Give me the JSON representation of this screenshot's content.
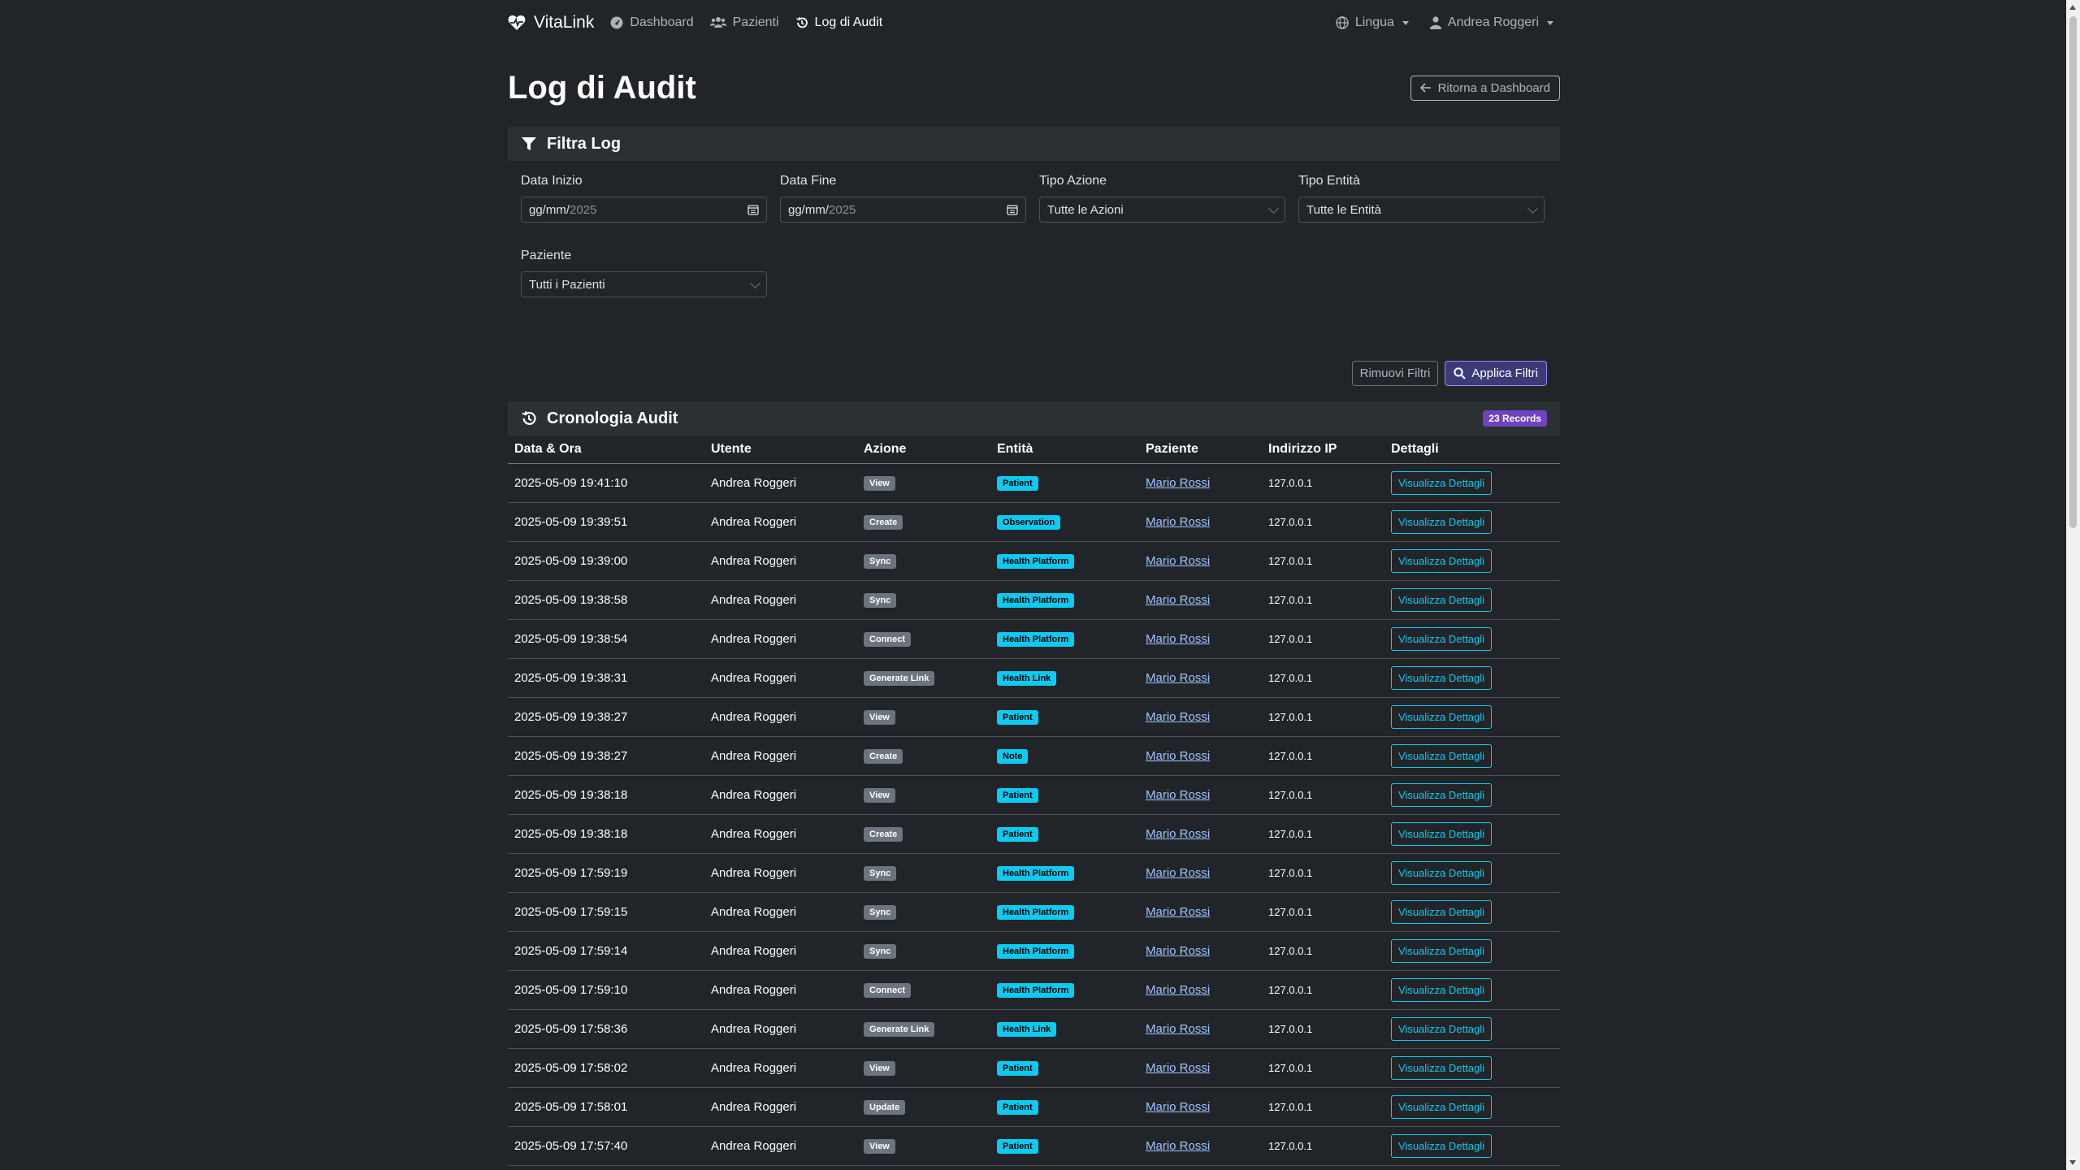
{
  "nav": {
    "brand": "VitaLink",
    "links": [
      {
        "label": "Dashboard",
        "icon": "tachometer-icon"
      },
      {
        "label": "Pazienti",
        "icon": "users-icon"
      },
      {
        "label": "Log di Audit",
        "icon": "history-icon"
      }
    ],
    "language": "Lingua",
    "user": "Andrea Roggeri"
  },
  "header": {
    "title": "Log di Audit",
    "back_button": "Ritorna a Dashboard"
  },
  "filters": {
    "title": "Filtra Log",
    "start_date": {
      "label": "Data Inizio",
      "value_prefix": "gg/mm/",
      "value_year": "2025"
    },
    "end_date": {
      "label": "Data Fine",
      "value_prefix": "gg/mm/",
      "value_year": "2025"
    },
    "action_type": {
      "label": "Tipo Azione",
      "value": "Tutte le Azioni"
    },
    "entity_type": {
      "label": "Tipo Entità",
      "value": "Tutte le Entità"
    },
    "patient": {
      "label": "Paziente",
      "value": "Tutti i Pazienti"
    },
    "remove_button": "Rimuovi Filtri",
    "apply_button": "Applica Filtri"
  },
  "audit": {
    "title": "Cronologia Audit",
    "records_badge": "23 Records",
    "columns": [
      "Data & Ora",
      "Utente",
      "Azione",
      "Entità",
      "Paziente",
      "Indirizzo IP",
      "Dettagli"
    ],
    "detail_label": "Visualizza Dettagli",
    "rows": [
      {
        "datetime": "2025-05-09 19:41:10",
        "user": "Andrea Roggeri",
        "action": "View",
        "entity": "Patient",
        "patient": "Mario Rossi",
        "ip": "127.0.0.1"
      },
      {
        "datetime": "2025-05-09 19:39:51",
        "user": "Andrea Roggeri",
        "action": "Create",
        "entity": "Observation",
        "patient": "Mario Rossi",
        "ip": "127.0.0.1"
      },
      {
        "datetime": "2025-05-09 19:39:00",
        "user": "Andrea Roggeri",
        "action": "Sync",
        "entity": "Health Platform",
        "patient": "Mario Rossi",
        "ip": "127.0.0.1"
      },
      {
        "datetime": "2025-05-09 19:38:58",
        "user": "Andrea Roggeri",
        "action": "Sync",
        "entity": "Health Platform",
        "patient": "Mario Rossi",
        "ip": "127.0.0.1"
      },
      {
        "datetime": "2025-05-09 19:38:54",
        "user": "Andrea Roggeri",
        "action": "Connect",
        "entity": "Health Platform",
        "patient": "Mario Rossi",
        "ip": "127.0.0.1"
      },
      {
        "datetime": "2025-05-09 19:38:31",
        "user": "Andrea Roggeri",
        "action": "Generate Link",
        "entity": "Health Link",
        "patient": "Mario Rossi",
        "ip": "127.0.0.1"
      },
      {
        "datetime": "2025-05-09 19:38:27",
        "user": "Andrea Roggeri",
        "action": "View",
        "entity": "Patient",
        "patient": "Mario Rossi",
        "ip": "127.0.0.1"
      },
      {
        "datetime": "2025-05-09 19:38:27",
        "user": "Andrea Roggeri",
        "action": "Create",
        "entity": "Note",
        "patient": "Mario Rossi",
        "ip": "127.0.0.1"
      },
      {
        "datetime": "2025-05-09 19:38:18",
        "user": "Andrea Roggeri",
        "action": "View",
        "entity": "Patient",
        "patient": "Mario Rossi",
        "ip": "127.0.0.1"
      },
      {
        "datetime": "2025-05-09 19:38:18",
        "user": "Andrea Roggeri",
        "action": "Create",
        "entity": "Patient",
        "patient": "Mario Rossi",
        "ip": "127.0.0.1"
      },
      {
        "datetime": "2025-05-09 17:59:19",
        "user": "Andrea Roggeri",
        "action": "Sync",
        "entity": "Health Platform",
        "patient": "Mario Rossi",
        "ip": "127.0.0.1"
      },
      {
        "datetime": "2025-05-09 17:59:15",
        "user": "Andrea Roggeri",
        "action": "Sync",
        "entity": "Health Platform",
        "patient": "Mario Rossi",
        "ip": "127.0.0.1"
      },
      {
        "datetime": "2025-05-09 17:59:14",
        "user": "Andrea Roggeri",
        "action": "Sync",
        "entity": "Health Platform",
        "patient": "Mario Rossi",
        "ip": "127.0.0.1"
      },
      {
        "datetime": "2025-05-09 17:59:10",
        "user": "Andrea Roggeri",
        "action": "Connect",
        "entity": "Health Platform",
        "patient": "Mario Rossi",
        "ip": "127.0.0.1"
      },
      {
        "datetime": "2025-05-09 17:58:36",
        "user": "Andrea Roggeri",
        "action": "Generate Link",
        "entity": "Health Link",
        "patient": "Mario Rossi",
        "ip": "127.0.0.1"
      },
      {
        "datetime": "2025-05-09 17:58:02",
        "user": "Andrea Roggeri",
        "action": "View",
        "entity": "Patient",
        "patient": "Mario Rossi",
        "ip": "127.0.0.1"
      },
      {
        "datetime": "2025-05-09 17:58:01",
        "user": "Andrea Roggeri",
        "action": "Update",
        "entity": "Patient",
        "patient": "Mario Rossi",
        "ip": "127.0.0.1"
      },
      {
        "datetime": "2025-05-09 17:57:40",
        "user": "Andrea Roggeri",
        "action": "View",
        "entity": "Patient",
        "patient": "Mario Rossi",
        "ip": "127.0.0.1"
      }
    ]
  },
  "colors": {
    "background": "#212529",
    "card_header": "#2b3035",
    "entity_badge": "#0dcaf0",
    "action_badge": "#6c757d",
    "records_badge": "#6f42c1",
    "link": "#9ec5fe"
  }
}
